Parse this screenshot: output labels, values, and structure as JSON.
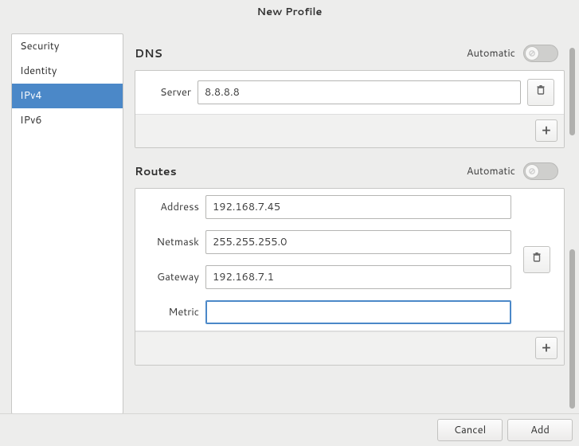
{
  "window": {
    "title": "New Profile"
  },
  "sidebar": {
    "items": [
      {
        "label": "Security",
        "name": "sidebar-item-security"
      },
      {
        "label": "Identity",
        "name": "sidebar-item-identity"
      },
      {
        "label": "IPv4",
        "name": "sidebar-item-ipv4",
        "selected": true
      },
      {
        "label": "IPv6",
        "name": "sidebar-item-ipv6"
      }
    ]
  },
  "dns": {
    "title": "DNS",
    "automatic_label": "Automatic",
    "automatic_on": false,
    "server_label": "Server",
    "server_value": "8.8.8.8",
    "add_label": "+"
  },
  "routes": {
    "title": "Routes",
    "automatic_label": "Automatic",
    "automatic_on": false,
    "fields": {
      "address_label": "Address",
      "address_value": "192.168.7.45",
      "netmask_label": "Netmask",
      "netmask_value": "255.255.255.0",
      "gateway_label": "Gateway",
      "gateway_value": "192.168.7.1",
      "metric_label": "Metric",
      "metric_value": ""
    },
    "add_label": "+"
  },
  "actions": {
    "cancel": "Cancel",
    "add": "Add"
  },
  "icons": {
    "trash": "trash-icon",
    "plus": "plus-icon",
    "switch": "switch-off-icon"
  }
}
